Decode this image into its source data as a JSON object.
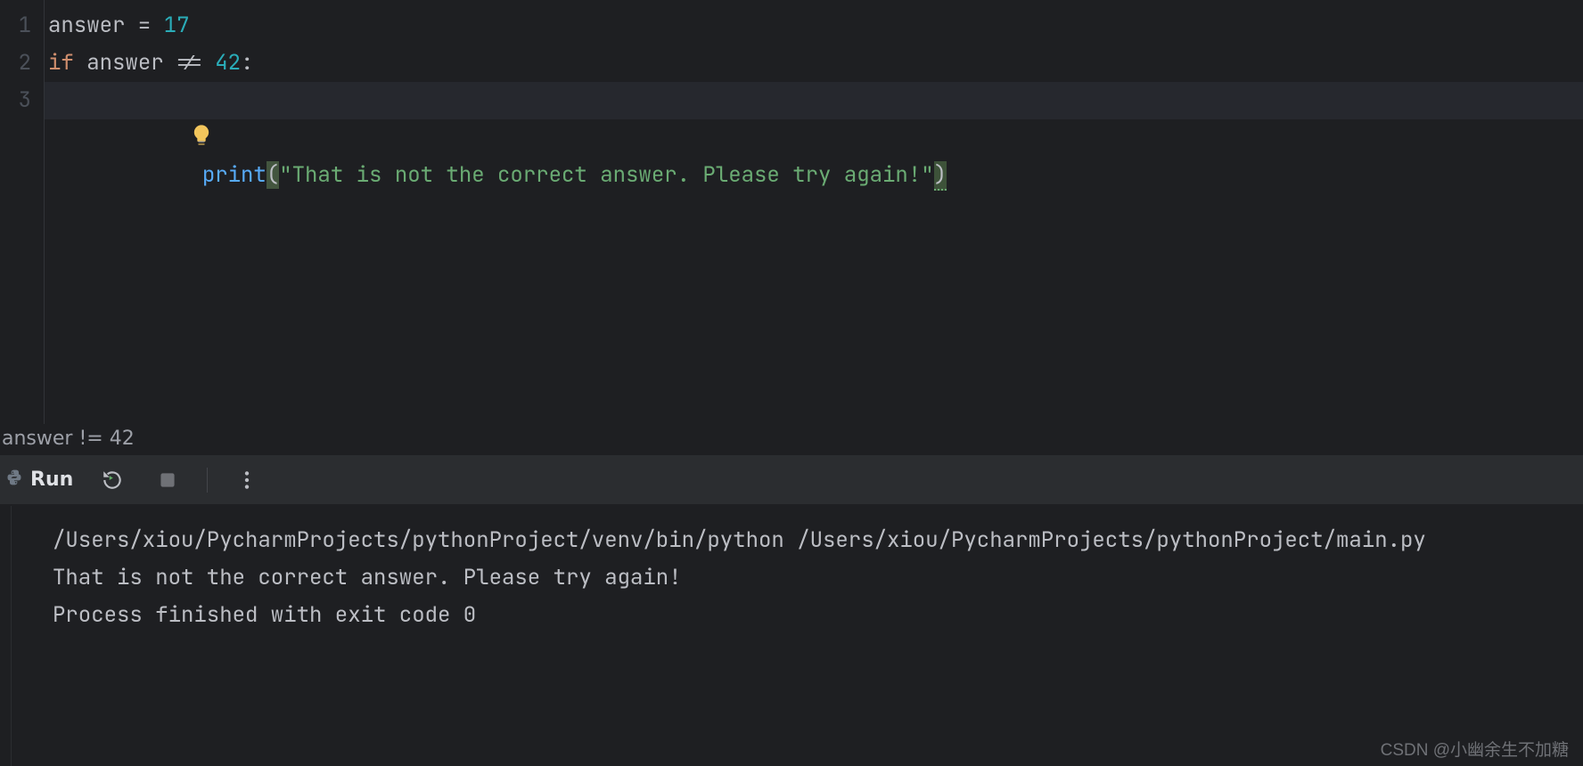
{
  "editor": {
    "lines": [
      "1",
      "2",
      "3"
    ],
    "code": {
      "l1": {
        "id": "answer",
        "op1": " = ",
        "num": "17"
      },
      "l2": {
        "kw": "if",
        "sp": " ",
        "id": "answer",
        "op": " != ",
        "num": "42",
        "colon": ":"
      },
      "l3": {
        "indent": "    ",
        "fn": "print",
        "lp": "(",
        "str": "\"That is not the correct answer. Please try again!\"",
        "rp": ")"
      }
    }
  },
  "breadcrumb": "answer != 42",
  "run": {
    "label": "Run"
  },
  "console": {
    "cmd": "/Users/xiou/PycharmProjects/pythonProject/venv/bin/python /Users/xiou/PycharmProjects/pythonProject/main.py",
    "out1": "That is not the correct answer. Please try again!",
    "blank": "",
    "exit": "Process finished with exit code 0"
  },
  "watermark": "CSDN @小幽余生不加糖"
}
